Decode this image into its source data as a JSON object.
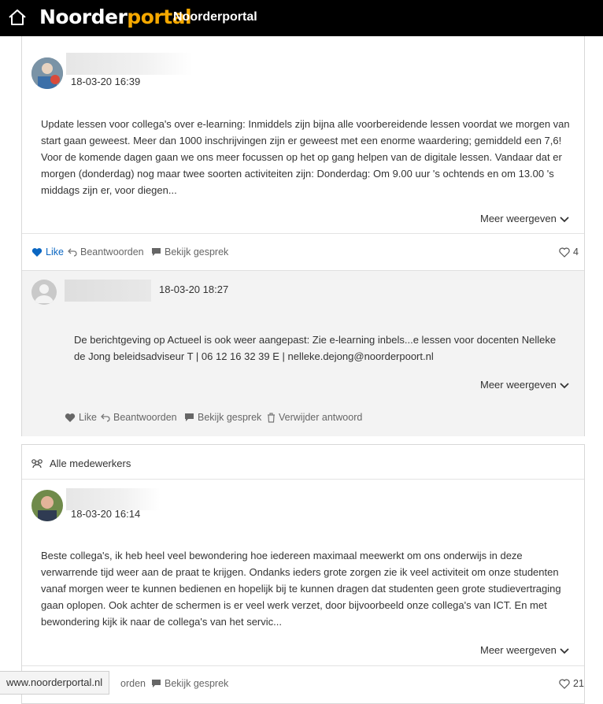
{
  "app": {
    "logo_part1": "Noorder",
    "logo_part2": "portal",
    "title": "Noorderportal"
  },
  "post1": {
    "timestamp": "18-03-20 16:39",
    "body": "Update lessen voor collega's over e-learning: Inmiddels zijn bijna alle voorbereidende lessen voordat we morgen van start gaan geweest. Meer dan 1000 inschrijvingen zijn er geweest met een enorme waardering; gemiddeld een 7,6!   Voor de komende dagen gaan we ons meer focussen op het op gang helpen van de digitale lessen. Vandaar dat er morgen (donderdag) nog maar twee soorten activiteiten zijn:   Donderdag: Om 9.00 uur 's ochtends en om 13.00 's middags zijn er, voor diegen...",
    "show_more": "Meer weergeven",
    "actions": {
      "like": "Like",
      "reply": "Beantwoorden",
      "view": "Bekijk gesprek"
    },
    "likes": "4"
  },
  "reply1": {
    "timestamp": "18-03-20 18:27",
    "body": "De berichtgeving op Actueel is ook weer aangepast: Zie e-learning inbels...e lessen voor docenten Nelleke de Jong beleidsadviseur T | 06 12 16 32 39 E | nelleke.dejong@noorderpoort.nl",
    "show_more": "Meer weergeven",
    "actions": {
      "like": "Like",
      "reply": "Beantwoorden",
      "view": "Bekijk gesprek",
      "delete": "Verwijder antwoord"
    }
  },
  "post2": {
    "group": "Alle medewerkers",
    "timestamp": "18-03-20 16:14",
    "body": "Beste collega's, ik heb heel veel bewondering hoe iedereen maximaal meewerkt om ons onderwijs in deze verwarrende tijd weer aan de praat te krijgen. Ondanks ieders grote zorgen zie ik veel activiteit om onze studenten vanaf morgen weer te kunnen bedienen en hopelijk bij te kunnen dragen dat studenten geen grote studievertraging gaan oplopen. Ook achter de schermen is er veel werk verzet, door bijvoorbeeld onze collega's van ICT. En met bewondering kijk ik naar de collega's van het servic...",
    "show_more": "Meer weergeven",
    "actions": {
      "reply_partial": "orden",
      "view": "Bekijk gesprek"
    },
    "likes": "21"
  },
  "statusbar": {
    "url": "www.noorderportal.nl"
  },
  "colors": {
    "topbar": "#000000",
    "logo_accent": "#f5a800",
    "like_blue": "#0a66c2",
    "reply_bg": "#f3f3f3"
  }
}
